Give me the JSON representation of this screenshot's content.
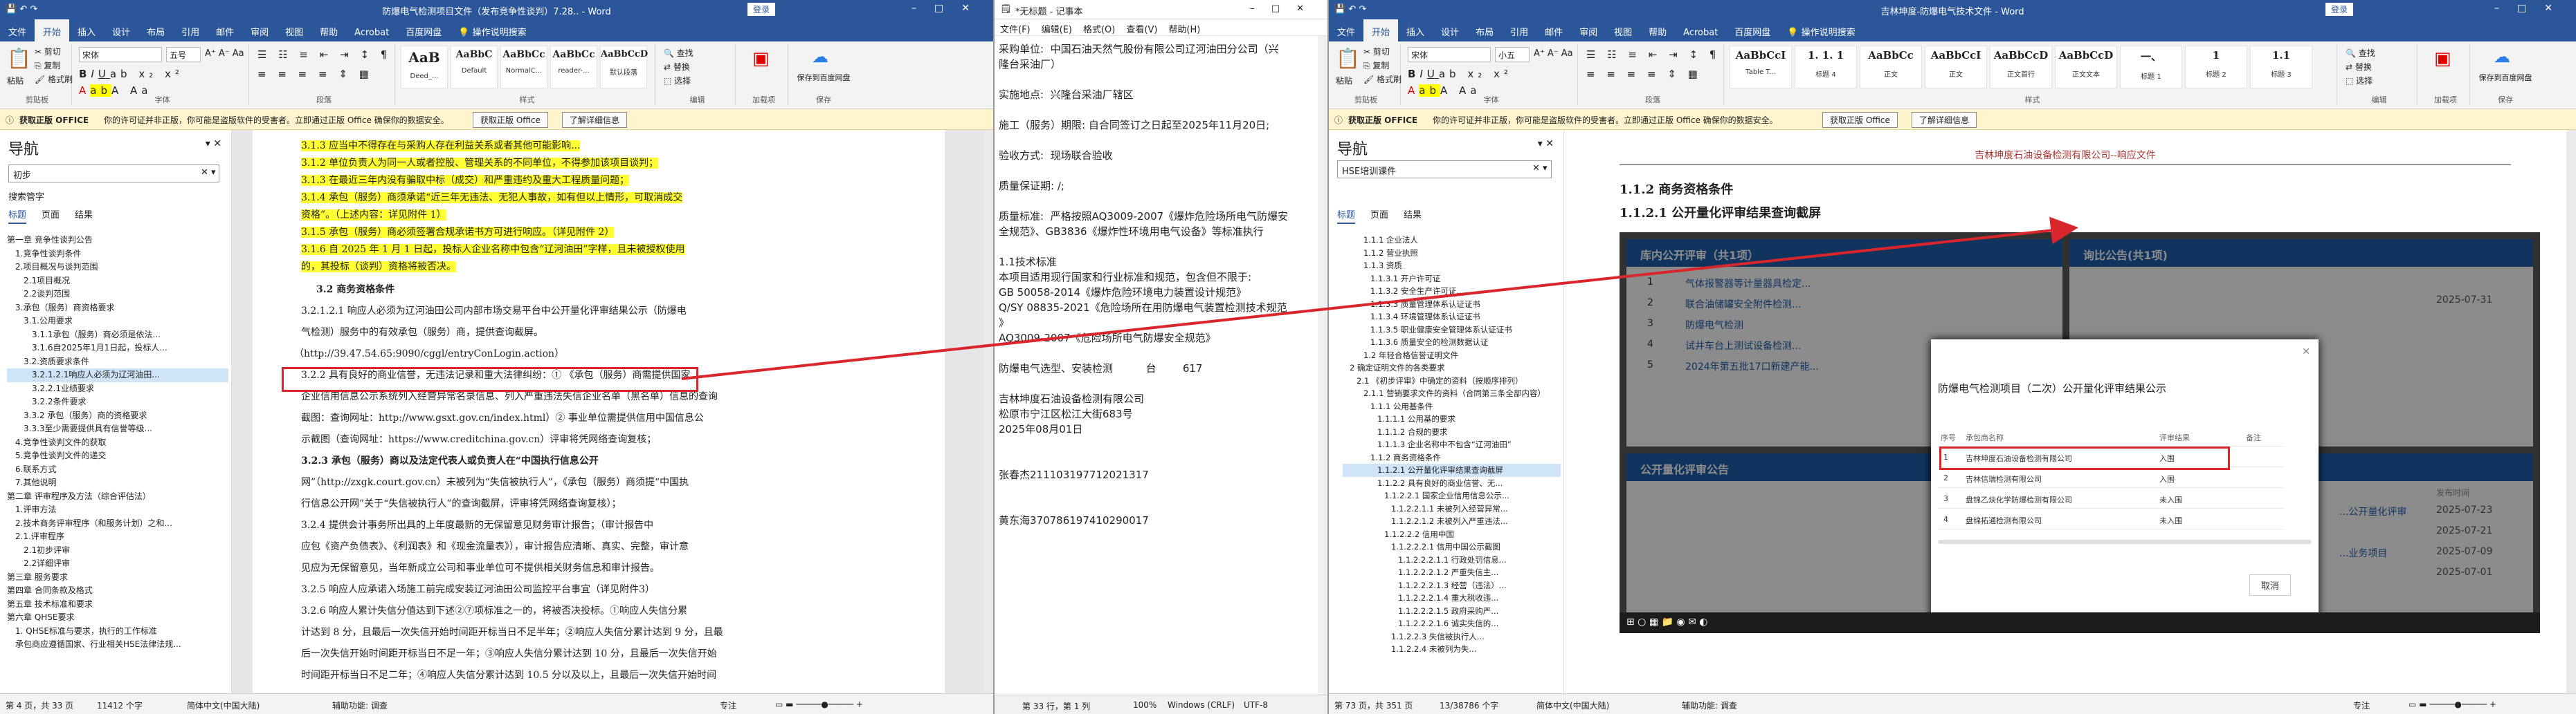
{
  "ribbon": {
    "tabs": [
      "文件",
      "开始",
      "插入",
      "设计",
      "布局",
      "引用",
      "邮件",
      "审阅",
      "视图",
      "帮助",
      "Acrobat",
      "百度网盘"
    ],
    "tell_me": "操作说明搜索",
    "clipboard": {
      "paste": "粘贴",
      "cut": "剪切",
      "copy": "复制",
      "format_painter": "格式刷",
      "group": "剪贴板"
    },
    "font": {
      "group": "字体",
      "size": "五号"
    },
    "paragraph_group": "段落",
    "styles_group": "样式",
    "find": "查找",
    "replace": "替换",
    "select": "选择",
    "editing_group": "编辑",
    "baidu_save": "保存到百度网盘",
    "baidu_group": "保存",
    "acrobat_group": "加载项"
  },
  "notice": {
    "title": "获取正版 OFFICE",
    "text": "你的许可证并非正版，你可能是盗版软件的受害者。立即通过正版 Office 确保你的数据安全。",
    "btn_genuine": "获取正版 Office",
    "btn_learn": "了解详细信息"
  },
  "left": {
    "title": "防爆电气检测项目文件（发布竞争性谈判）7.28.. - Word",
    "font_name": "宋体",
    "styles": [
      {
        "preview": "AaB",
        "name": "Deed_..."
      },
      {
        "preview": "AaBbC",
        "name": "Default"
      },
      {
        "preview": "AaBbCc",
        "name": "NormalC..."
      },
      {
        "preview": "AaBbCc",
        "name": "reader-..."
      },
      {
        "preview": "AaBbCcD",
        "name": "默认段落"
      }
    ],
    "nav": {
      "title": "导航",
      "search": "初步",
      "search_label": "搜索管字",
      "tabs": [
        "标题",
        "页面",
        "结果"
      ],
      "items": [
        "第一章 竞争性谈判公告",
        "1.竞争性谈判条件",
        "2.项目概况与谈判范围",
        "2.1项目概况",
        "2.2谈判范围",
        "3.承包（服务）商资格要求",
        "3.1.公用要求",
        "3.1.1承包（服务）商必须是依法...",
        "3.1.6自2025年1月1日起，投标人...",
        "3.2.资质要求条件",
        "3.2.1.2.1响应人必须为辽河油田...",
        "3.2.2.1业绩要求",
        "3.2.2条件要求",
        "3.3.2 承包（服务）商的资格要求",
        "3.3.3至少需要提供具有信誉等级...",
        "4.竞争性谈判文件的获取",
        "5.竞争性谈判文件的递交",
        "6.联系方式",
        "7.其他说明",
        "第二章 评审程序及方法（综合评估法）",
        "1.评审方法",
        "2.技术商务评审程序（和服务计划）之和...",
        "2.1.评审程序",
        "2.1初步评审",
        "2.2详细评审",
        "第三章 服务要求",
        "第四章 合同条款及格式",
        "第五章 技术标准和要求",
        "第六章 QHSE要求",
        "1. QHSE标准与要求，执行的工作标准",
        "承包商应遵循国家、行业相关HSE法律法规..."
      ]
    },
    "doc": [
      "3.1.3 应当中不得存在与采购人存在利益关系或者其他可能影响...",
      "3.1.2 单位负责人为同一人或者控股、管理关系的不同单位，不得参加该项目谈判；",
      "3.1.3 在最近三年内没有骗取中标（成交）和严重违约及重大工程质量问题；",
      "3.1.4 承包（服务）商须承诺“近三年无违法、无犯人事故，如有但以上情形，可取消成交",
      "资格”。（上述内容：详见附件 1）",
      "3.1.5 承包（服务）商必须签署合规承诺书方可进行响应。（详见附件 2）",
      "3.1.6 自 2025 年 1 月 1 日起，投标人企业名称中包含“辽河油田”字样，且未被授权使用",
      "的，其投标（谈判）资格将被否决。",
      "3.2 商务资格条件",
      "3.2.1.2.1 响应人必须为辽河油田公司内部市场交易平台中公开量化评审结果公示（防爆电",
      "气检测）服务中的有效承包（服务）商，提供查询截屏。",
      "（http://39.47.54.65:9090/cggl/entryConLogin.action）",
      "3.2.2 具有良好的商业信誉，无违法记录和重大法律纠纷：① 《承包（服务）商需提供国家",
      "企业信用信息公示系统列入经营异常名录信息、列入严重违法失信企业名单（黑名单）信息的查询",
      "截图：查询网址：http://www.gsxt.gov.cn/index.html）② 事业单位需提供信用中国信息公",
      "示截图（查询网址：https://www.creditchina.gov.cn）评审将凭网络查询复核；",
      "3.2.3 承包（服务）商以及法定代表人或负责人在“中国执行信息公开",
      "网”（http://zxgk.court.gov.cn）未被列为“失信被执行人”，《承包（服务）商须提“中国执",
      "行信息公开网”关于“失信被执行人”的查询截屏，评审将凭网络查询复核）；",
      "3.2.4 提供会计事务所出具的上年度最新的无保留意见财务审计报告；（审计报告中",
      "应包《资产负债表》、《利润表》和《现金流量表》），审计报告应清晰、真实、完整，审计意",
      "见应为无保留意见，当年新成立公司和事业单位可不提供相关财务信息和审计报告。",
      "3.2.5 响应人应承诺入场施工前完成安装辽河油田公司监控平台事宜（详见附件3）",
      "3.2.6 响应人累计失信分值达到下述②⑦项标准之一的，将被否决投标。①响应人失信分累",
      "计达到 8 分，且最后一次失信开始时间距开标当日不足半年；②响应人失信分累计达到 9 分，且最",
      "后一次失信开始时间距开标当日不足一年；③响应人失信分累计达到 10 分，且最后一次失信开始",
      "时间距开标当日不足二年；④响应人失信分累计达到 10.5 分以及以上，且最后一次失信开始时间"
    ],
    "status": [
      "第 4 页，共 33 页",
      "11412 个字",
      "简体中文(中国大陆)",
      "辅助功能: 调查",
      "专注"
    ]
  },
  "notepad": {
    "title": "*无标题 - 记事本",
    "menu": [
      "文件(F)",
      "编辑(E)",
      "格式(O)",
      "查看(V)",
      "帮助(H)"
    ],
    "lines": [
      "采购单位:  中国石油天然气股份有限公司辽河油田分公司（兴",
      "隆台采油厂）",
      "",
      "实施地点:  兴隆台采油厂辖区",
      "",
      "施工（服务）期限: 自合同签订之日起至2025年11月20日;",
      "",
      "验收方式:  现场联合验收",
      "",
      "质量保证期: /;",
      "",
      "质量标准:  严格按照AQ3009-2007《爆炸危险场所电气防爆安",
      "全规范》、GB3836《爆炸性环境用电气设备》等标准执行",
      "",
      "1.1技术标准",
      "本项目适用现行国家和行业标准和规范，包含但不限于:",
      "GB 50058-2014《爆炸危险环境电力装置设计规范》",
      "Q/SY 08835-2021《危险场所在用防爆电气装置检测技术规范",
      "》",
      "AQ3009-2007《危险场所电气防爆安全规范》",
      "",
      "防爆电气选型、安装检测          台        617",
      "",
      "吉林坤度石油设备检测有限公司",
      "松原市宁江区松江大街683号",
      "2025年08月01日",
      "",
      "",
      "张春杰211103197712021317",
      "",
      "",
      "黄东海370786197410290017"
    ],
    "status": [
      "第 33 行，第 1 列",
      "100%",
      "Windows (CRLF)",
      "UTF-8"
    ]
  },
  "right": {
    "title": "吉林坤度-防爆电气技术文件 - Word",
    "font_name": "宋体",
    "font_size": "小五",
    "styles": [
      {
        "preview": "AaBbCcI",
        "name": "Table T..."
      },
      {
        "preview": "1. 1. 1",
        "name": "标题 4"
      },
      {
        "preview": "AaBbCc",
        "name": "正文"
      },
      {
        "preview": "AaBbCcI",
        "name": "正文"
      },
      {
        "preview": "AaBbCcD",
        "name": "正文首行"
      },
      {
        "preview": "AaBbCcD",
        "name": "正文文本"
      },
      {
        "preview": "一、",
        "name": "标题 1"
      },
      {
        "preview": "1",
        "name": "标题 2"
      },
      {
        "preview": "1.1",
        "name": "标题 3"
      }
    ],
    "nav": {
      "title": "导航",
      "search": "HSE培训课件",
      "tabs": [
        "标题",
        "页面",
        "结果"
      ],
      "items": [
        "1.1.1 企业法人",
        "1.1.2 营业执照",
        "1.1.3 资质",
        "1.1.3.1 开户许可证",
        "1.1.3.2 安全生产许可证...",
        "1.1.3.3 质量管理体系认证证书",
        "1.1.3.4 环境管理体系认证证书",
        "1.1.3.5 职业健康安全管理体系认证证书",
        "1.1.3.6 质量安全的检测数据认证",
        "1.2 年轻合格信誉证明文件",
        "2 确定证明文件的各类要求",
        "2.1 《初步评审》中确定的资料（按顺序排列）",
        "2.1.1 营销要求文件的资料（合同第三条全部内容）",
        "1.1.1 公用基条件",
        "1.1.1.1 公用基的要求",
        "1.1.1.2 合规的要求",
        "1.1.1.3 企业名称中不包含“辽河油田”",
        "1.1.2 商务资格条件",
        "1.1.2.1 公开量化评审结果查询截屏",
        "1.1.2.2 具有良好的商业信誉、无...",
        "1.1.2.2.1 国家企业信用信息公示...",
        "1.1.2.2.1.1 未被列入经营异常...",
        "1.1.2.2.1.2 未被列入严重违法...",
        "1.1.2.2.2 信用中国",
        "1.1.2.2.2.1 信用中国公示截图",
        "1.1.2.2.2.1.1 行政处罚信息...",
        "1.1.2.2.2.1.2 严重失信主...",
        "1.1.2.2.2.1.3 经营（违法）...",
        "1.1.2.2.2.1.4 重大税收违...",
        "1.1.2.2.2.1.5 政府采购严...",
        "1.1.2.2.2.1.6 诚实失信的...",
        "1.1.2.2.3 失信被执行人...",
        "1.1.2.2.4 未被列为失..."
      ]
    },
    "doc": {
      "header": "吉林坤度石油设备检测有限公司--响应文件",
      "h1": "1.1.2    商务资格条件",
      "h2": "1.1.2.1  公开量化评审结果查询截屏"
    },
    "shot": {
      "panel1_title": "库内公开评审（共1项）",
      "panel2_title": "询比公告(共1项)",
      "panel3_title": "公开量化评审公告",
      "rows": [
        {
          "n": "1",
          "t": "气体报警器等计量器具检定...",
          "d": ""
        },
        {
          "n": "2",
          "t": "联合油储罐安全附件检测...",
          "d": ""
        },
        {
          "n": "3",
          "t": "防爆电气检测",
          "d": ""
        },
        {
          "n": "4",
          "t": "试井车台上测试设备检测...",
          "d": ""
        },
        {
          "n": "5",
          "t": "2024年第五批17口新建产能...",
          "d": ""
        }
      ],
      "side_rows": [
        {
          "t": "2025-07-31"
        },
        {
          "t": "2025-07-23"
        },
        {
          "t": "2025-07-21"
        },
        {
          "t": "2025-07-09"
        },
        {
          "t": "2025-07-01"
        }
      ],
      "side_links": [
        "...公开量化评审",
        "...业务项目"
      ],
      "side_header": "发布时间",
      "dialog": {
        "title": "防爆电气检测项目（二次）公开量化评审结果公示",
        "cols": [
          "序号",
          "承包商名称",
          "评审结果",
          "备注"
        ],
        "rows": [
          {
            "n": "1",
            "name": "吉林坤度石油设备检测有限公司",
            "res": "入围",
            "memo": ""
          },
          {
            "n": "2",
            "name": "吉林信瑞检测有限公司",
            "res": "入围",
            "memo": ""
          },
          {
            "n": "3",
            "name": "盘锦乙炔化学防爆检测有限公司",
            "res": "未入围",
            "memo": ""
          },
          {
            "n": "4",
            "name": "盘锦拓通检测有限公司",
            "res": "未入围",
            "memo": ""
          }
        ],
        "cancel": "取消"
      }
    },
    "status": [
      "第 73 页，共 351 页",
      "13/38786 个字",
      "简体中文(中国大陆)",
      "辅助功能: 调查",
      "专注"
    ]
  }
}
